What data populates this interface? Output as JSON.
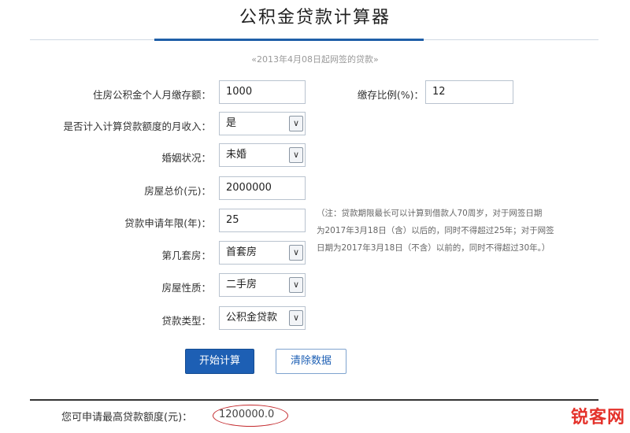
{
  "page": {
    "title": "公积金贷款计算器",
    "subtitle": "«2013年4月08日起网签的贷款»"
  },
  "form": {
    "monthly_deposit": {
      "label": "住房公积金个人月缴存额：",
      "value": "1000"
    },
    "deposit_ratio": {
      "label": "缴存比例(%)：",
      "value": "12"
    },
    "include_income": {
      "label": "是否计入计算贷款额度的月收入：",
      "value": "是"
    },
    "marital_status": {
      "label": "婚姻状况：",
      "value": "未婚"
    },
    "house_price": {
      "label": "房屋总价(元)：",
      "value": "2000000"
    },
    "loan_years": {
      "label": "贷款申请年限(年)：",
      "value": "25"
    },
    "house_count": {
      "label": "第几套房：",
      "value": "首套房"
    },
    "house_type": {
      "label": "房屋性质：",
      "value": "二手房"
    },
    "loan_type": {
      "label": "贷款类型：",
      "value": "公积金贷款"
    }
  },
  "note": {
    "lines": [
      "（注：贷款期限最长可以计算到借款人70周岁，对于网签日期",
      "为2017年3月18日（含）以后的，同时不得超过25年；对于网签",
      "日期为2017年3月18日（不含）以前的，同时不得超过30年。）"
    ]
  },
  "buttons": {
    "calculate": "开始计算",
    "clear": "清除数据"
  },
  "result": {
    "label": "您可申请最高贷款额度(元)：",
    "value": "1200000.0"
  },
  "watermark": {
    "logo_text": "锐客网"
  },
  "icons": {
    "dropdown": "chevron-down-icon"
  },
  "colors": {
    "accent": "#1d5fb4",
    "annotation": "#c3272b",
    "logo": "#e4322b"
  }
}
